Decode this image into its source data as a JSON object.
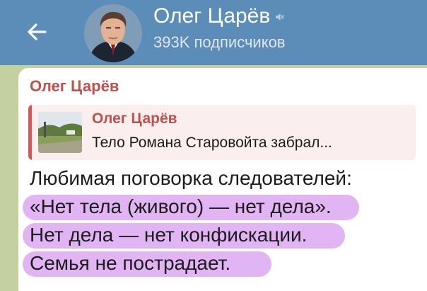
{
  "header": {
    "title": "Олег Царёв",
    "subtitle": "393K подписчиков",
    "icons": {
      "back": "arrow-left-icon",
      "mute": "mute-icon"
    }
  },
  "message": {
    "sender": "Олег Царёв",
    "reply": {
      "name": "Олег Царёв",
      "text": "Тело Романа Старовойта забрал..."
    },
    "lines": [
      "Любимая поговорка следователей:",
      "«Нет тела (живого) — нет дела».",
      "Нет дела — нет конфискации.",
      "Семья не пострадает."
    ]
  },
  "colors": {
    "header": "#5c8db8",
    "accent": "#c0504b",
    "highlight": "#c878eb"
  }
}
